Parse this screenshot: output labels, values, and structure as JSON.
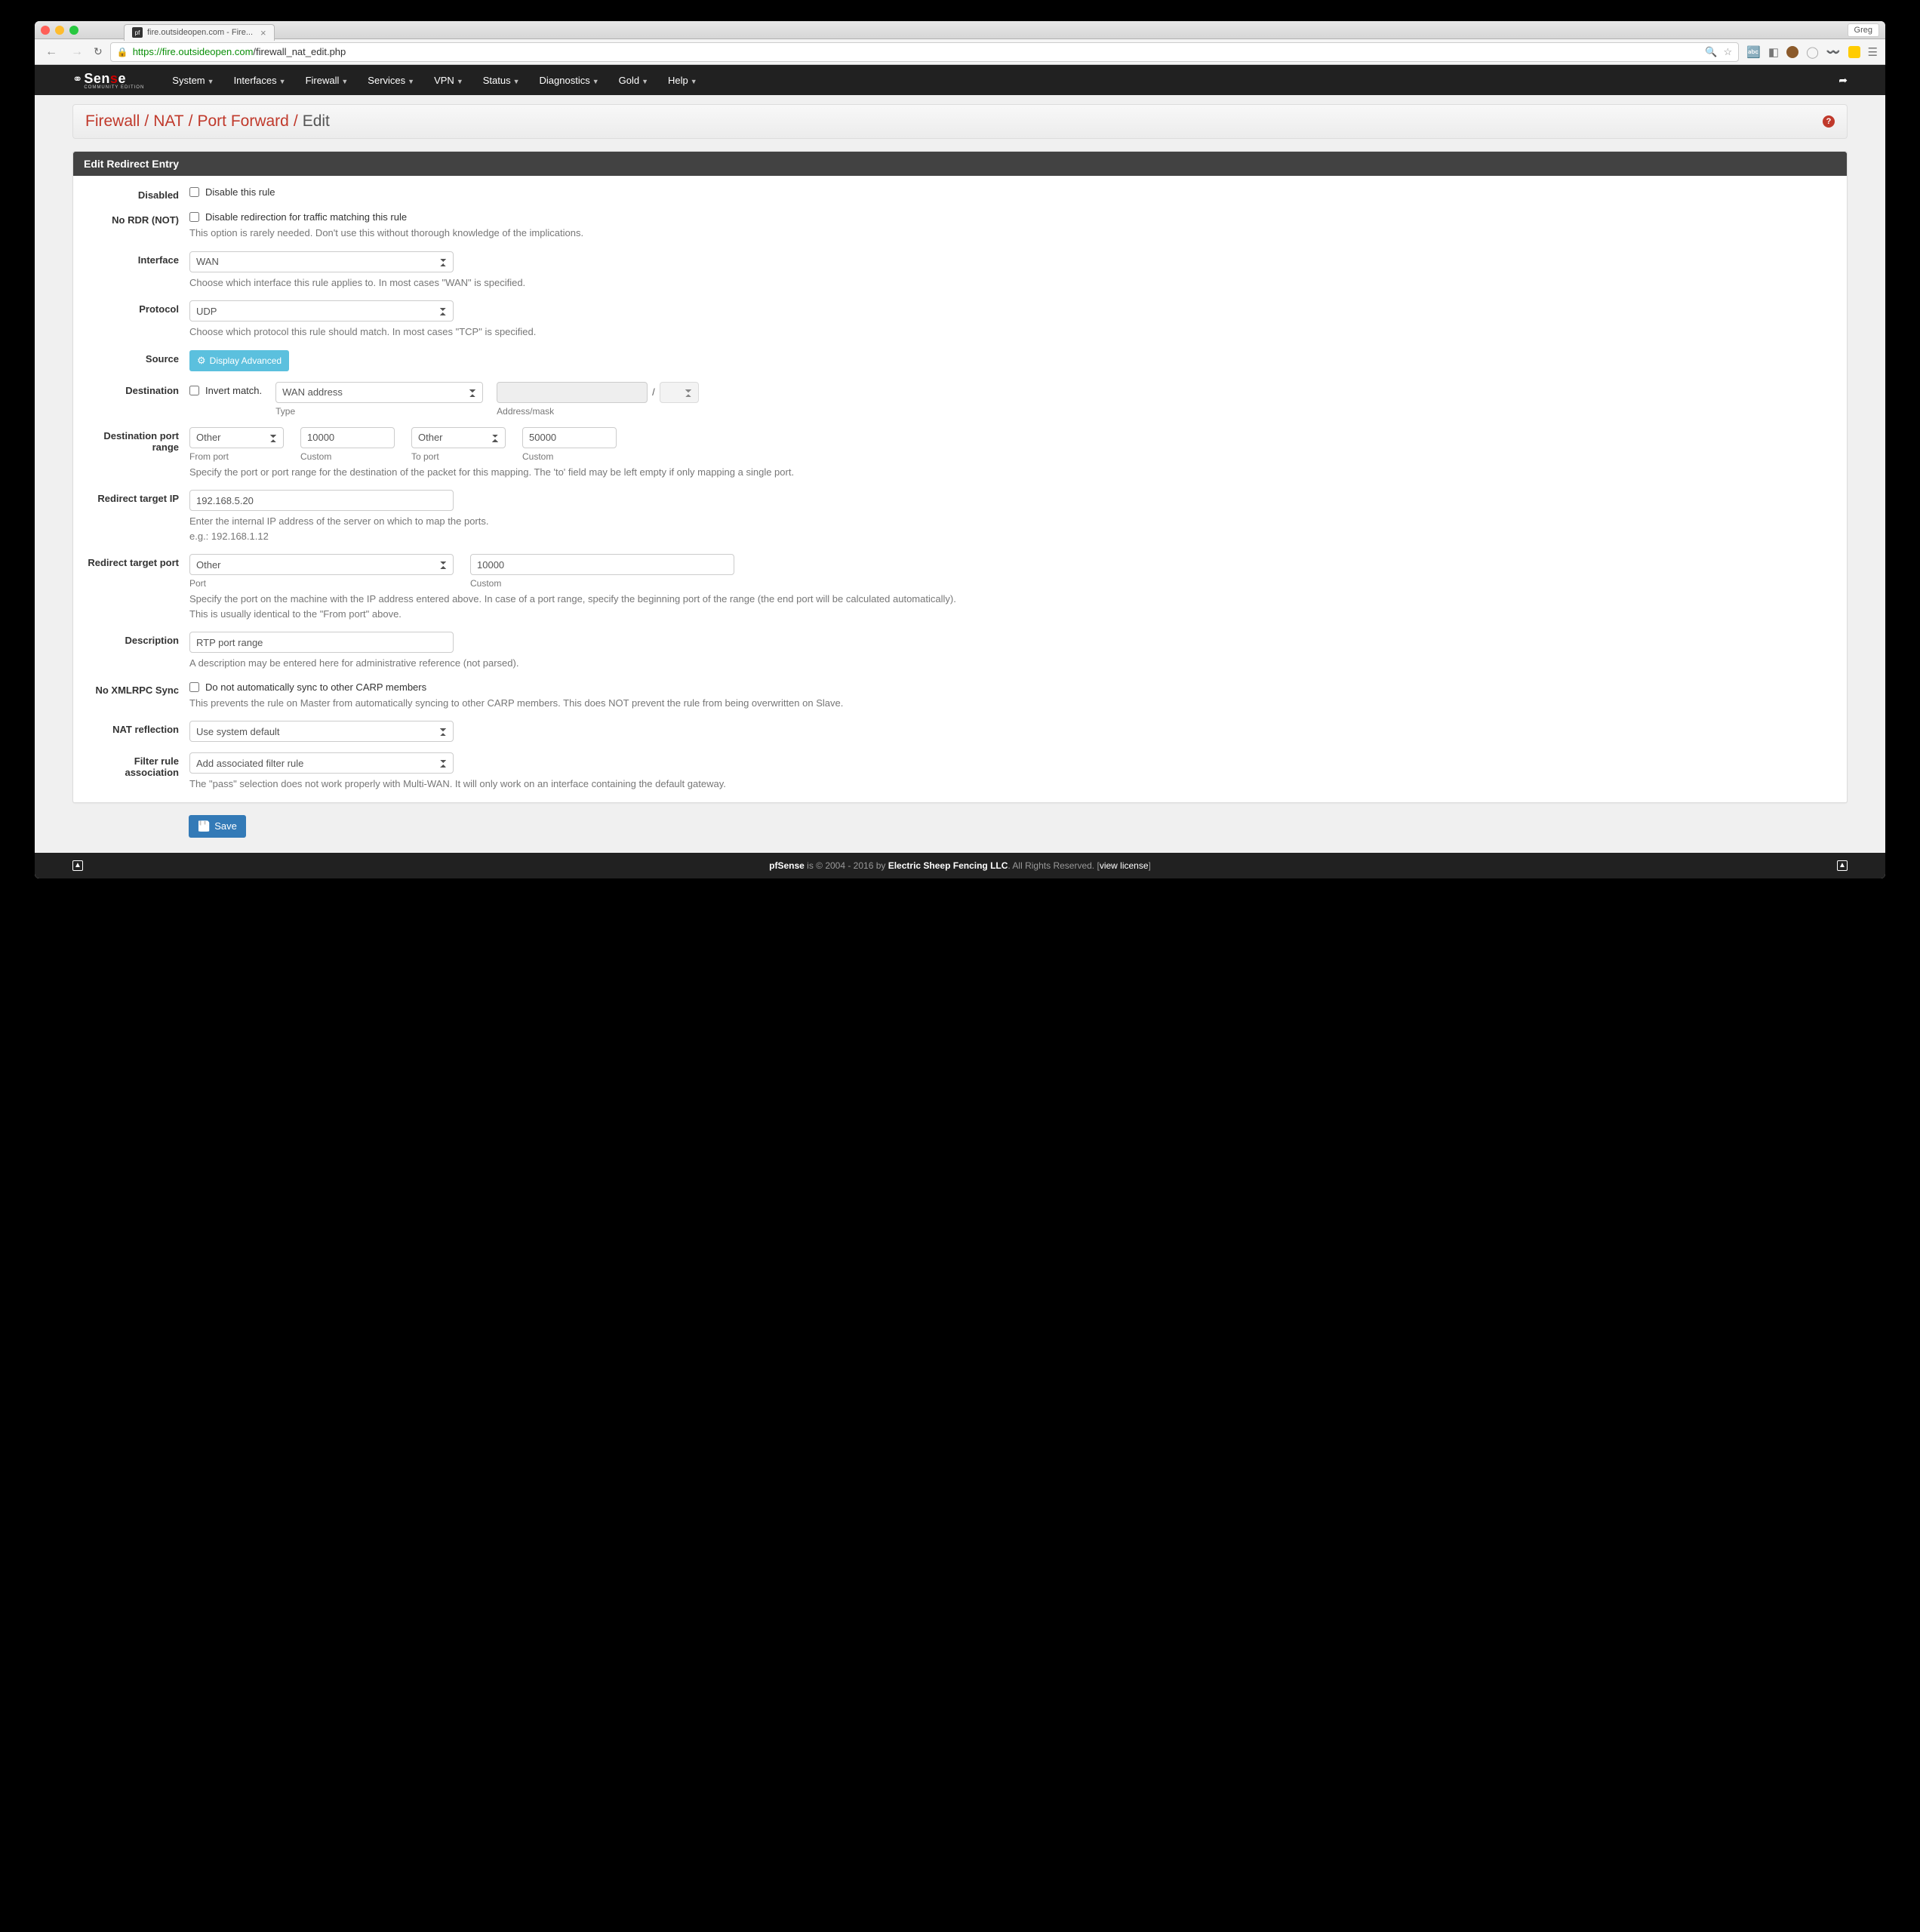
{
  "browser": {
    "tab_title": "fire.outsideopen.com - Fire...",
    "user": "Greg",
    "url_secure": "https",
    "url_host": "://fire.outsideopen.com",
    "url_path": "/firewall_nat_edit.php"
  },
  "nav": {
    "logo_main": "Sen",
    "logo_s": "s",
    "logo_e": "e",
    "logo_sub": "COMMUNITY EDITION",
    "items": [
      "System",
      "Interfaces",
      "Firewall",
      "Services",
      "VPN",
      "Status",
      "Diagnostics",
      "Gold",
      "Help"
    ]
  },
  "breadcrumb": {
    "parts": [
      "Firewall",
      "NAT",
      "Port Forward",
      "Edit"
    ]
  },
  "panel_title": "Edit Redirect Entry",
  "form": {
    "disabled": {
      "label": "Disabled",
      "check": "Disable this rule"
    },
    "nordr": {
      "label": "No RDR (NOT)",
      "check": "Disable redirection for traffic matching this rule",
      "help": "This option is rarely needed. Don't use this without thorough knowledge of the implications."
    },
    "interface": {
      "label": "Interface",
      "value": "WAN",
      "help": "Choose which interface this rule applies to. In most cases \"WAN\" is specified."
    },
    "protocol": {
      "label": "Protocol",
      "value": "UDP",
      "help": "Choose which protocol this rule should match. In most cases \"TCP\" is specified."
    },
    "source": {
      "label": "Source",
      "button": "Display Advanced"
    },
    "destination": {
      "label": "Destination",
      "invert": "Invert match.",
      "type_value": "WAN address",
      "type_label": "Type",
      "mask_label": "Address/mask"
    },
    "dport": {
      "label": "Destination port range",
      "from_sel": "Other",
      "from_custom": "10000",
      "from_label": "From port",
      "from_custom_label": "Custom",
      "to_sel": "Other",
      "to_custom": "50000",
      "to_label": "To port",
      "to_custom_label": "Custom",
      "help": "Specify the port or port range for the destination of the packet for this mapping. The 'to' field may be left empty if only mapping a single port."
    },
    "target_ip": {
      "label": "Redirect target IP",
      "value": "192.168.5.20",
      "help1": "Enter the internal IP address of the server on which to map the ports.",
      "help2": "e.g.: 192.168.1.12"
    },
    "target_port": {
      "label": "Redirect target port",
      "sel": "Other",
      "custom": "10000",
      "port_label": "Port",
      "custom_label": "Custom",
      "help1": "Specify the port on the machine with the IP address entered above. In case of a port range, specify the beginning port of the range (the end port will be calculated automatically).",
      "help2": "This is usually identical to the \"From port\" above."
    },
    "description": {
      "label": "Description",
      "value": "RTP port range",
      "help": "A description may be entered here for administrative reference (not parsed)."
    },
    "xmlrpc": {
      "label": "No XMLRPC Sync",
      "check": "Do not automatically sync to other CARP members",
      "help": "This prevents the rule on Master from automatically syncing to other CARP members. This does NOT prevent the rule from being overwritten on Slave."
    },
    "reflection": {
      "label": "NAT reflection",
      "value": "Use system default"
    },
    "assoc": {
      "label": "Filter rule association",
      "value": "Add associated filter rule",
      "help": "The \"pass\" selection does not work properly with Multi-WAN. It will only work on an interface containing the default gateway."
    },
    "save": "Save"
  },
  "footer": {
    "brand": "pfSense",
    "text1": " is © 2004 - 2016 by ",
    "company": "Electric Sheep Fencing LLC",
    "text2": ". All Rights Reserved. [",
    "link": "view license",
    "text3": "]"
  }
}
